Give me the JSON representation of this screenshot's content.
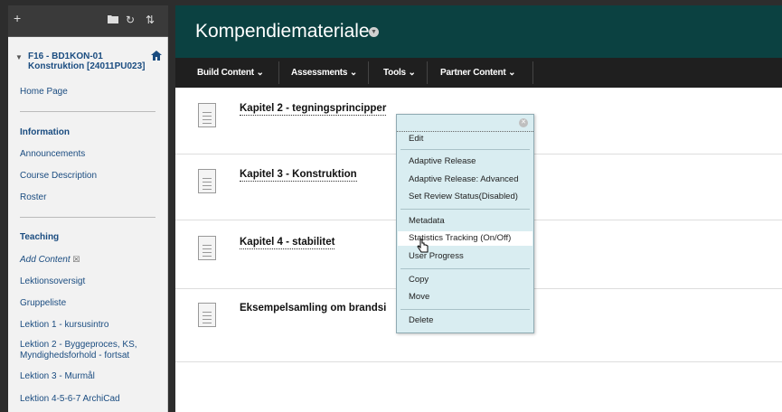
{
  "sidebar": {
    "top_icons": {
      "add": "+",
      "folder": "folder-icon",
      "refresh": "↻",
      "sort": "⇅"
    },
    "course_title": "F16 - BD1KON-01 Konstruktion [24011PU023]",
    "home_label": "Home Page",
    "information_heading": "Information",
    "information_items": [
      "Announcements",
      "Course Description",
      "Roster"
    ],
    "teaching_heading": "Teaching",
    "add_content_label": "Add Content",
    "teaching_items": [
      "Lektionsoversigt",
      "Gruppeliste",
      "Lektion 1 - kursusintro",
      "Lektion 2 - Byggeproces, KS, Myndighedsforhold - fortsat",
      "Lektion 3 - Murmål",
      "Lektion 4-5-6-7 ArchiCad"
    ]
  },
  "header": {
    "title": "Kompendiemateriale"
  },
  "toolbar": {
    "items": [
      "Build Content ⌄",
      "Assessments ⌄",
      "Tools ⌄",
      "Partner Content ⌄"
    ]
  },
  "content_items": [
    "Kapitel 2 - tegningsprincipper",
    "Kapitel 3 - Konstruktion",
    "Kapitel 4 - stabilitet",
    "Eksempelsamling om brandsi"
  ],
  "context_menu": {
    "items": [
      "Edit",
      "Adaptive Release",
      "Adaptive Release: Advanced",
      "Set Review Status(Disabled)",
      "Metadata",
      "Statistics Tracking (On/Off)",
      "User Progress",
      "Copy",
      "Move",
      "Delete"
    ],
    "highlighted": "Statistics Tracking (On/Off)"
  },
  "colors": {
    "header": "#0b4141",
    "toolbar": "#1f1f1f",
    "menu": "#d9edf1",
    "link": "#1a4c80"
  }
}
